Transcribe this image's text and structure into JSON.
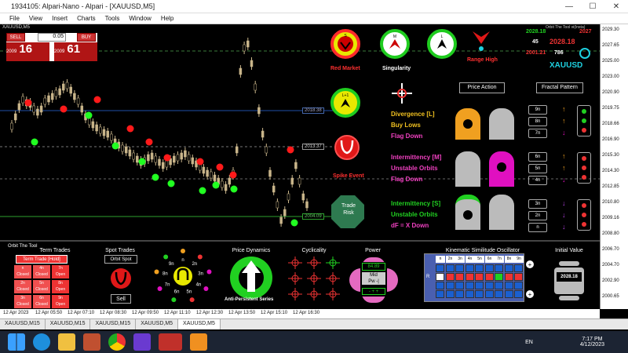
{
  "window": {
    "title": "1934105: Alpari-Nano - Alpari - [XAUUSD,M5]",
    "min": "—",
    "max": "☐",
    "close": "✕"
  },
  "menu": [
    "File",
    "View",
    "Insert",
    "Charts",
    "Tools",
    "Window",
    "Help"
  ],
  "symbol_label": "XAUUSD,M5",
  "trade": {
    "sell": "SELL",
    "buy": "BUY",
    "lot": "0.05",
    "sell_small": "2009",
    "sell_big": "16",
    "buy_small": "2009",
    "buy_big": "61"
  },
  "yaxis": [
    "2029.30",
    "2027.65",
    "2025.00",
    "2023.00",
    "2020.90",
    "2019.75",
    "2018.66",
    "2016.90",
    "2015.30",
    "2014.30",
    "2012.85",
    "2010.80",
    "2009.16",
    "2008.80",
    "2006.70",
    "2004.70",
    "2002.90",
    "2000.65"
  ],
  "price_tags": {
    "p1": "2018.38",
    "p2": "2013.37",
    "p3": "2009.16",
    "p4": "2004.09"
  },
  "xaxis": [
    "12 Apr 2023",
    "12 Apr 05:50",
    "12 Apr 07:10",
    "12 Apr 08:30",
    "12 Apr 09:50",
    "12 Apr 11:10",
    "12 Apr 12:30",
    "12 Apr 13:50",
    "12 Apr 15:10",
    "12 Apr 16:30"
  ],
  "tabs": [
    "XAUUSD,M15",
    "XAUUSD,M15",
    "XAUUSD,M15",
    "XAUUSD,M5",
    "XAUUSD,M5"
  ],
  "top_indicators": {
    "s_label": "S",
    "m_label": "M",
    "l_label": "L",
    "red_market": "Red Market",
    "singularity": "Singularity",
    "range_high": "Range High",
    "l_plus": "L+1",
    "spike_event": "Spike Event",
    "trade_risk": "Trade Risk"
  },
  "header_right": {
    "tool_label": "Orbit The Tool vi(Insta)",
    "v1": "2028.18",
    "v2": "2027",
    "n45": "45",
    "v3": "2028.18",
    "v4": "2001.21",
    "n786": "786",
    "symbol": "XAUUSD"
  },
  "signals": {
    "price_action": "Price Action",
    "fractal_pattern": "Fractal Pattern",
    "L": {
      "line1": "Divergence [L]",
      "line2": "Buy Lows",
      "line3": "Flag Down",
      "counts": [
        "9n",
        "8n",
        "7n"
      ]
    },
    "M": {
      "line1": "Intermittency [M]",
      "line2": "Unstable Orbits",
      "line3": "Flag Down",
      "counts": [
        "6n",
        "5n",
        "4n"
      ]
    },
    "S": {
      "line1": "Intermittency [S]",
      "line2": "Unstable Orbits",
      "line3": "dF = X Down",
      "counts": [
        "3n",
        "2n",
        "n"
      ]
    }
  },
  "bottom": {
    "orbit_tool": "Orbit The Tool",
    "term_trades": "Term Trades",
    "term_trade_hold": "Term Trade [Hold]",
    "cells": [
      [
        "n\nClosed",
        "4n\nClosed",
        "7n\nOpen"
      ],
      [
        "2n\nClosed",
        "5n\nClosed",
        "8n\nOpen"
      ],
      [
        "3n\nClosed",
        "6n\nClosed",
        "9n\nOpen"
      ]
    ],
    "spot_trades": "Spot Trades",
    "orbit_spot": "Orbit Spot",
    "sell": "Sell",
    "ring_labels": [
      "n",
      "2n",
      "3n",
      "4n",
      "5n",
      "6n",
      "7n",
      "8n",
      "9n"
    ],
    "price_dynamics": "Price Dynamics",
    "anti_persistent": "Anti-Persistent Series",
    "cyclicality": "Cyclicality",
    "power": "Power",
    "power_value": "84.89",
    "power_mid": "Mid",
    "power_pw": "Pw -|",
    "power_arrows": "- + +",
    "kinematic": "Kinematic Similitude Oscillator",
    "k_header": [
      "n",
      "2n",
      "3n",
      "4n",
      "5n",
      "6n",
      "7n",
      "8n",
      "9n"
    ],
    "k_rows": [
      "R"
    ],
    "initial_value": "Initial Value",
    "initial_val": "2028.18"
  },
  "taskbar": {
    "lang": "EN",
    "time": "7:17 PM",
    "date": "4/12/2023"
  }
}
